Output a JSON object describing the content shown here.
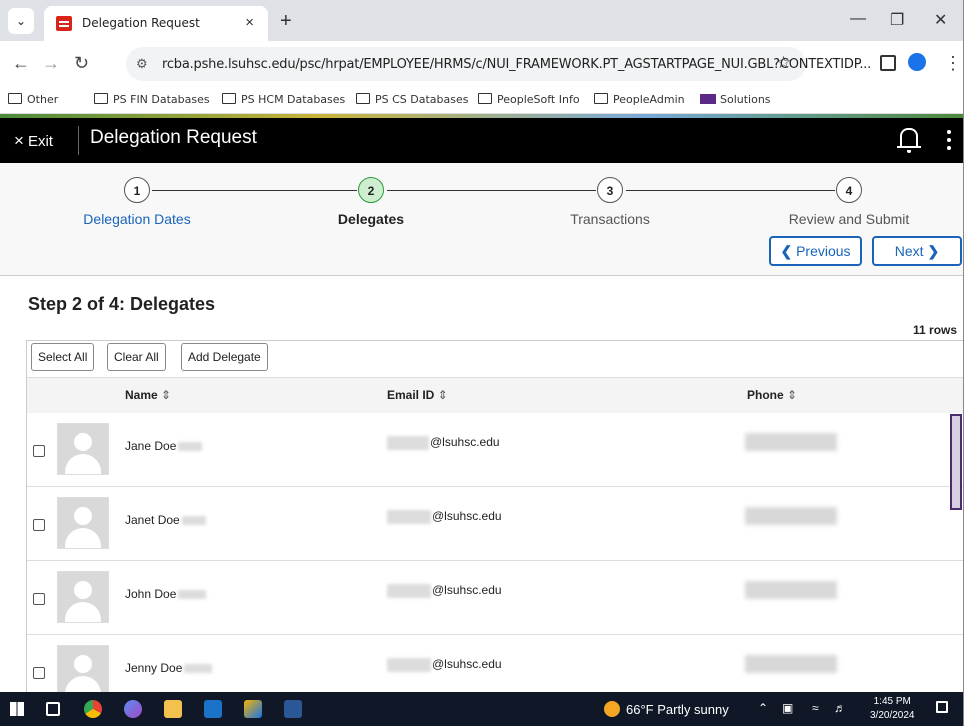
{
  "browser": {
    "tab_title": "Delegation Request",
    "tab_close": "×",
    "new_tab": "+",
    "url": "rcba.pshe.lsuhsc.edu/psc/hrpat/EMPLOYEE/HRMS/c/NUI_FRAMEWORK.PT_AGSTARTPAGE_NUI.GBL?CONTEXTIDP...",
    "bookmarks": [
      "Other",
      "PS FIN Databases",
      "PS HCM Databases",
      "PS CS Databases",
      "PeopleSoft Info",
      "PeopleAdmin",
      "Solutions"
    ]
  },
  "app": {
    "exit_label": "Exit",
    "title": "Delegation Request"
  },
  "stepper": {
    "steps": [
      {
        "number": "1",
        "label": "Delegation Dates"
      },
      {
        "number": "2",
        "label": "Delegates"
      },
      {
        "number": "3",
        "label": "Transactions"
      },
      {
        "number": "4",
        "label": "Review and Submit"
      }
    ],
    "active_step": 2,
    "previous_label": "Previous",
    "next_label": "Next"
  },
  "main": {
    "heading": "Step 2 of 4: Delegates",
    "row_count": "11 rows",
    "buttons": {
      "select_all": "Select All",
      "clear_all": "Clear All",
      "add_delegate": "Add Delegate"
    },
    "columns": {
      "name": "Name",
      "email": "Email ID",
      "phone": "Phone"
    },
    "rows": [
      {
        "name": "Jane Doe",
        "email": "@lsuhsc.edu"
      },
      {
        "name": "Janet Doe",
        "email": "@lsuhsc.edu"
      },
      {
        "name": "John Doe",
        "email": "@lsuhsc.edu"
      },
      {
        "name": "Jenny Doe",
        "email": "@lsuhsc.edu"
      }
    ]
  },
  "taskbar": {
    "weather": "66°F  Partly sunny",
    "time": "1:45 PM",
    "date": "3/20/2024"
  },
  "colors": {
    "accent_blue": "#1964b9",
    "active_step_green": "#2b9b3a",
    "header_black": "#000000",
    "scrollbar_purple": "#4a2b6e"
  }
}
